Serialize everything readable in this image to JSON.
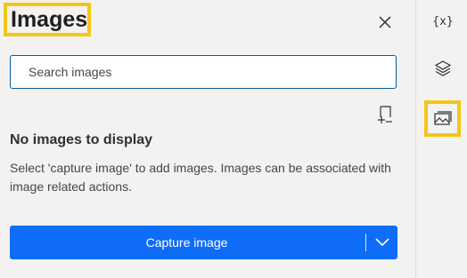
{
  "panel": {
    "title": "Images",
    "close_icon": "close-icon",
    "search": {
      "placeholder": "Search images",
      "value": ""
    },
    "add_capture_icon": "add-capture-icon",
    "empty_state": {
      "title": "No images to display",
      "description": "Select 'capture image' to add images. Images can be associated with image related actions."
    },
    "capture_button": {
      "label": "Capture image",
      "dropdown_icon": "chevron-down-icon"
    }
  },
  "rail": {
    "items": [
      {
        "label": "{x}",
        "icon": "variables-icon"
      },
      {
        "label": "",
        "icon": "layers-icon"
      },
      {
        "label": "",
        "icon": "images-icon",
        "selected": true
      }
    ]
  },
  "colors": {
    "accent": "#0f6cf7",
    "highlight": "#f5c518",
    "background": "#f3f2f1",
    "search_border": "#005a9e"
  }
}
